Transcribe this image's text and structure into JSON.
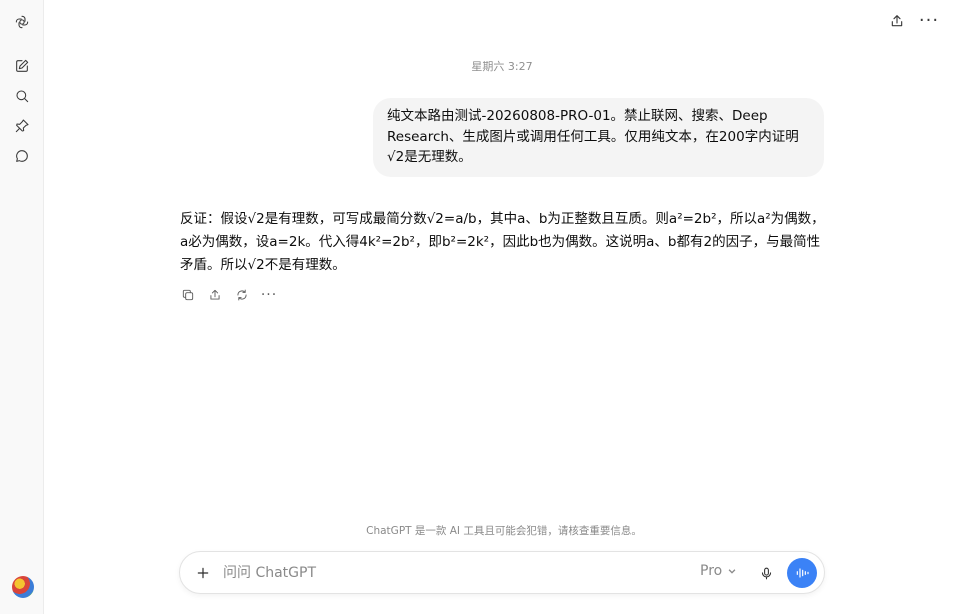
{
  "sidebar": {
    "items": [
      {
        "icon": "openai-logo-icon"
      },
      {
        "icon": "new-chat-icon"
      },
      {
        "icon": "search-icon"
      },
      {
        "icon": "pin-icon"
      },
      {
        "icon": "chat-bubble-icon"
      }
    ],
    "avatar": "user-avatar"
  },
  "header": {
    "actions": [
      {
        "icon": "share-icon"
      },
      {
        "icon": "more-icon",
        "glyph": "···"
      }
    ]
  },
  "conversation": {
    "timestamp": "星期六 3:27",
    "user_message": "纯文本路由测试-20260808-PRO-01。禁止联网、搜索、Deep Research、生成图片或调用任何工具。仅用纯文本，在200字内证明√2是无理数。",
    "assistant_message": "反证：假设√2是有理数，可写成最简分数√2=a/b，其中a、b为正整数且互质。则a²=2b²，所以a²为偶数，a必为偶数，设a=2k。代入得4k²=2b²，即b²=2k²，因此b也为偶数。这说明a、b都有2的因子，与最简性矛盾。所以√2不是有理数。",
    "message_actions": {
      "copy": "copy-icon",
      "share": "share-icon",
      "regenerate": "regenerate-icon",
      "more": "···"
    }
  },
  "footer": {
    "disclaimer": "ChatGPT 是一款 AI 工具且可能会犯错，请核查重要信息。"
  },
  "composer": {
    "placeholder": "问问 ChatGPT",
    "value": "",
    "model": "Pro",
    "voice_color": "#3b82f6"
  }
}
